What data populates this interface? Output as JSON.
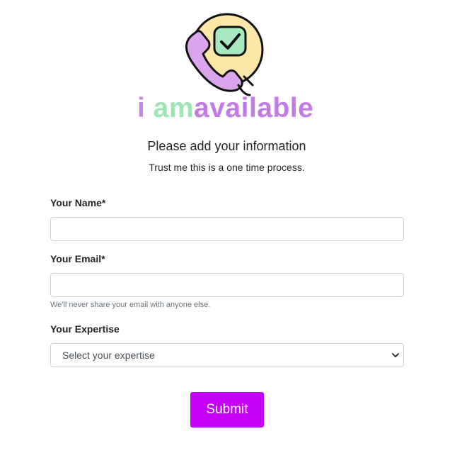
{
  "brand": {
    "wordmark_i": "i ",
    "wordmark_am": "am",
    "wordmark_available": "available",
    "logo_icon": "phone-check-icon",
    "colors": {
      "circle": "#fde7a8",
      "phone": "#d9a5ec",
      "check": "#a6e9c0",
      "outline": "#111111",
      "i": "#c985e6",
      "am": "#9ee5b4",
      "available": "#c17ae6"
    }
  },
  "header": {
    "title": "Please add your information",
    "subtitle": "Trust me this is a one time process."
  },
  "form": {
    "name_label": "Your Name*",
    "name_value": "",
    "name_placeholder": "",
    "email_label": "Your Email*",
    "email_value": "",
    "email_placeholder": "",
    "email_help": "We'll never share your email with anyone else.",
    "expertise_label": "Your Expertise",
    "expertise_selected": "Select your expertise",
    "submit_label": "Submit"
  },
  "theme": {
    "accent": "#c400f7"
  }
}
